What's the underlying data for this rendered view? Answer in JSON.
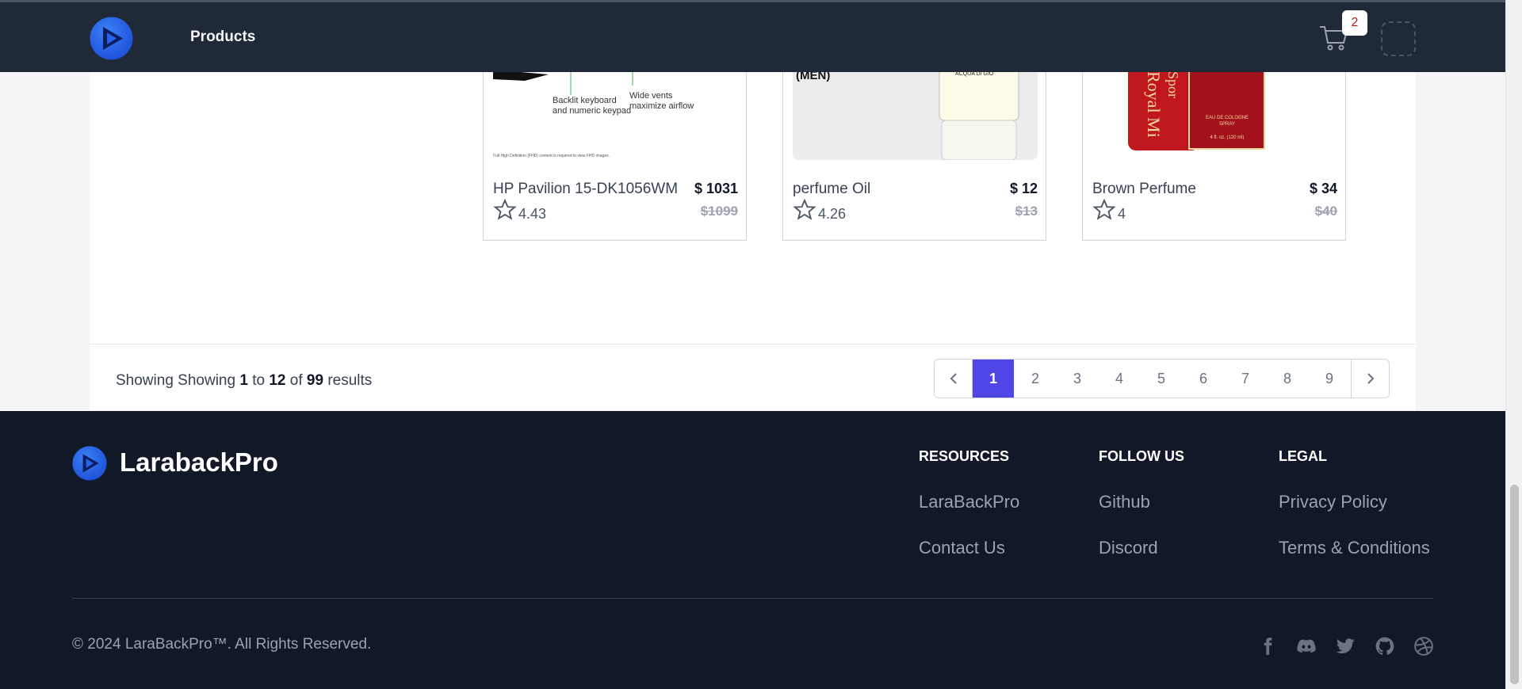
{
  "navbar": {
    "nav_link": "Products",
    "cart_count": "2"
  },
  "products": [
    {
      "name": "HP Pavilion 15-DK1056WM",
      "price": "$ 1031",
      "old_price": "$1099",
      "rating": "4.43",
      "image_text": {
        "line1": "Backlit keyboard",
        "line2": "and numeric keypad",
        "line3": "Wide vents",
        "line4": "maximize airflow",
        "fine": "Full High Definition (FHD) content is required to view FHD images."
      }
    },
    {
      "name": "perfume Oil",
      "price": "$ 12",
      "old_price": "$13",
      "rating": "4.26",
      "image_text": {
        "label": "(MEN)",
        "bottle": "ACQUA DI GIO"
      }
    },
    {
      "name": "Brown Perfume",
      "price": "$ 34",
      "old_price": "$40",
      "rating": "4",
      "image_text": {
        "bottle": "Royal Mi",
        "bottle2": "Spor",
        "box1": "EAU DE COLOGNE",
        "box2": "SPRAY",
        "box3": "4 fl. oz. (120 ml)"
      }
    }
  ],
  "pagination": {
    "showing_prefix": "Showing Showing",
    "from": "1",
    "to_word": "to",
    "to": "12",
    "of_word": "of",
    "total": "99",
    "results_word": "results",
    "pages": [
      "1",
      "2",
      "3",
      "4",
      "5",
      "6",
      "7",
      "8",
      "9"
    ],
    "active_page": "1"
  },
  "footer": {
    "brand": "LarabackPro",
    "columns": [
      {
        "heading": "RESOURCES",
        "links": [
          "LaraBackPro",
          "Contact Us"
        ]
      },
      {
        "heading": "FOLLOW US",
        "links": [
          "Github",
          "Discord"
        ]
      },
      {
        "heading": "LEGAL",
        "links": [
          "Privacy Policy",
          "Terms & Conditions"
        ]
      }
    ],
    "copyright": "© 2024 LaraBackPro™. All Rights Reserved.",
    "social_icons": [
      "facebook-icon",
      "discord-icon",
      "twitter-icon",
      "github-icon",
      "dribbble-icon"
    ]
  },
  "colors": {
    "navbar": "#1f2937",
    "footer": "#111827",
    "active_page": "#4f46e5",
    "badge_text": "#b91c1c"
  }
}
